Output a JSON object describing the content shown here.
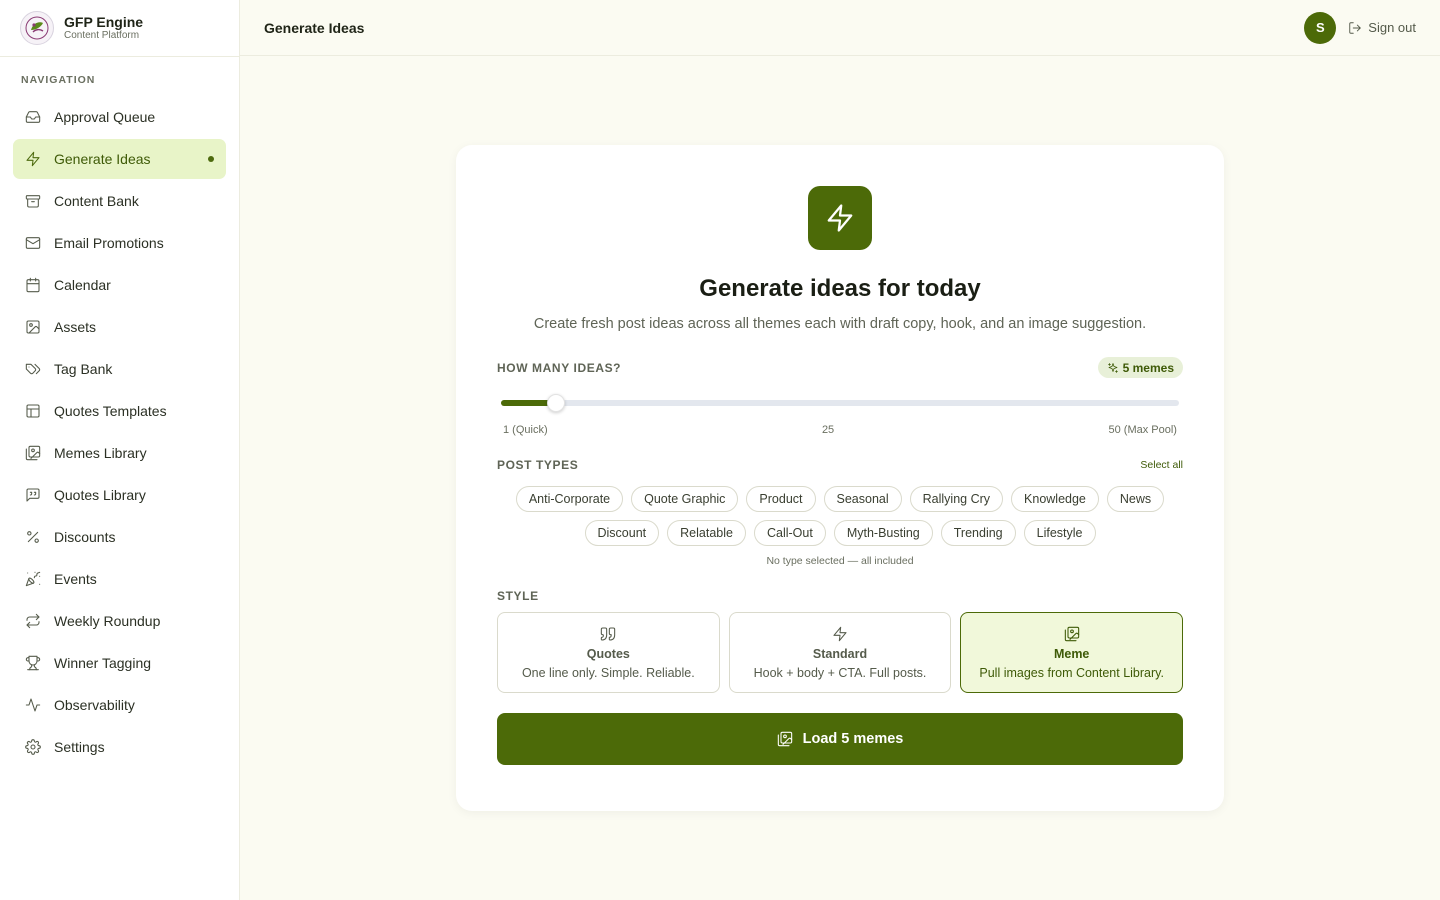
{
  "brand": {
    "name": "GFP Engine",
    "subtitle": "Content Platform"
  },
  "sidebar": {
    "heading": "NAVIGATION",
    "items": [
      {
        "label": "Approval Queue",
        "icon": "inbox-icon"
      },
      {
        "label": "Generate Ideas",
        "icon": "lightning-icon",
        "active": true
      },
      {
        "label": "Content Bank",
        "icon": "archive-icon"
      },
      {
        "label": "Email Promotions",
        "icon": "mail-icon"
      },
      {
        "label": "Calendar",
        "icon": "calendar-icon"
      },
      {
        "label": "Assets",
        "icon": "image-icon"
      },
      {
        "label": "Tag Bank",
        "icon": "tags-icon"
      },
      {
        "label": "Quotes Templates",
        "icon": "layout-icon"
      },
      {
        "label": "Memes Library",
        "icon": "images-icon"
      },
      {
        "label": "Quotes Library",
        "icon": "quote-message-icon"
      },
      {
        "label": "Discounts",
        "icon": "percent-icon"
      },
      {
        "label": "Events",
        "icon": "party-icon"
      },
      {
        "label": "Weekly Roundup",
        "icon": "repeat-icon"
      },
      {
        "label": "Winner Tagging",
        "icon": "trophy-icon"
      },
      {
        "label": "Observability",
        "icon": "activity-icon"
      },
      {
        "label": "Settings",
        "icon": "gear-icon"
      }
    ]
  },
  "header": {
    "title": "Generate Ideas",
    "avatar_initial": "S",
    "signout_label": "Sign out"
  },
  "card": {
    "title": "Generate ideas for today",
    "description": "Create fresh post ideas across all themes each with draft copy, hook, and an image suggestion.",
    "count": {
      "label": "HOW MANY IDEAS?",
      "badge": "5 memes",
      "value": 5,
      "min": 1,
      "max": 50,
      "min_label": "1 (Quick)",
      "mid_label": "25",
      "max_label": "50 (Max Pool)"
    },
    "post_types": {
      "label": "POST TYPES",
      "select_all": "Select all",
      "chips": [
        "Anti-Corporate",
        "Quote Graphic",
        "Product",
        "Seasonal",
        "Rallying Cry",
        "Knowledge",
        "News",
        "Discount",
        "Relatable",
        "Call-Out",
        "Myth-Busting",
        "Trending",
        "Lifestyle"
      ],
      "note": "No type selected — all included"
    },
    "style": {
      "label": "STYLE",
      "options": [
        {
          "name": "Quotes",
          "desc": "One line only. Simple. Reliable.",
          "icon": "quote-icon"
        },
        {
          "name": "Standard",
          "desc": "Hook + body + CTA. Full posts.",
          "icon": "lightning-icon"
        },
        {
          "name": "Meme",
          "desc": "Pull images from Content Library.",
          "icon": "images-icon",
          "selected": true
        }
      ]
    },
    "button_label": "Load 5 memes"
  },
  "colors": {
    "accent": "#4c6a08",
    "active_bg": "#e8f4c8",
    "page_bg": "#fbfbf2"
  }
}
